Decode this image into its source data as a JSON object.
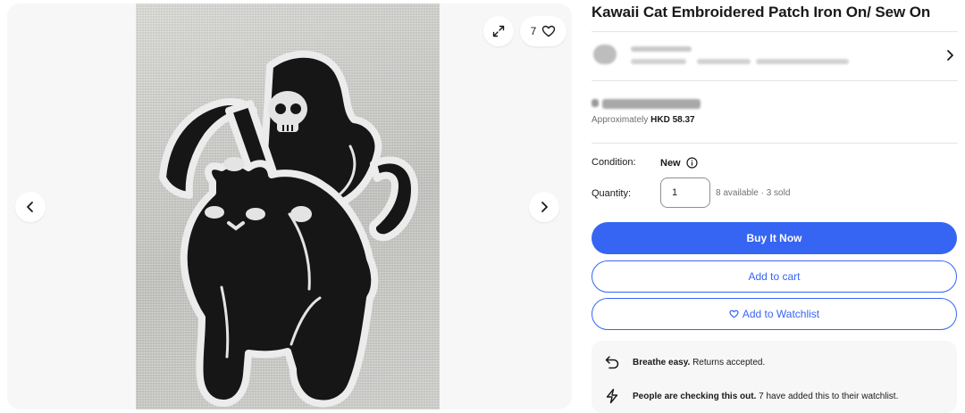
{
  "gallery": {
    "watch_count": "7",
    "icons": {
      "prev": "chevron-left-icon",
      "next": "chevron-right-icon",
      "expand": "expand-icon",
      "heart": "heart-icon"
    }
  },
  "listing": {
    "title": "Kawaii Cat Embroidered Patch Iron On/ Sew On",
    "approx_prefix": "Approximately",
    "approx_price": "HKD 58.37",
    "condition_label": "Condition:",
    "condition_value": "New",
    "quantity_label": "Quantity:",
    "quantity_value": "1",
    "availability": "8 available · 3 sold"
  },
  "actions": {
    "buy_now": "Buy It Now",
    "add_to_cart": "Add to cart",
    "add_to_watchlist": "Add to Watchlist"
  },
  "info": {
    "returns_bold": "Breathe easy.",
    "returns_text": " Returns accepted.",
    "watch_bold": "People are checking this out.",
    "watch_text": " 7 have added this to their watchlist."
  },
  "colors": {
    "accent": "#3665f3",
    "text": "#191919",
    "muted": "#707070",
    "panel_bg": "#f7f7f7"
  }
}
